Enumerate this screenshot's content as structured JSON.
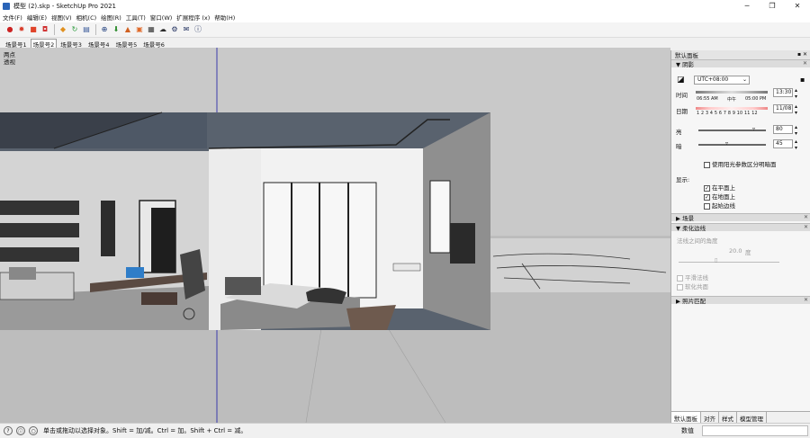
{
  "window": {
    "title": "模型 (2).skp - SketchUp Pro 2021",
    "minimize": "─",
    "maximize": "❐",
    "close": "✕"
  },
  "menu": [
    "文件(F)",
    "编辑(E)",
    "视图(V)",
    "相机(C)",
    "绘图(R)",
    "工具(T)",
    "窗口(W)",
    "扩展程序 (x)",
    "帮助(H)"
  ],
  "toolbar": {
    "icons": [
      {
        "name": "component-icon",
        "glyph": "●",
        "color": "#cc2222"
      },
      {
        "name": "settings-gear-icon",
        "glyph": "✹",
        "color": "#d83c2a"
      },
      {
        "name": "folder-icon",
        "glyph": "■",
        "color": "#e0442a"
      },
      {
        "name": "camera-icon",
        "glyph": "◘",
        "color": "#d03232"
      },
      {
        "name": "plugin-box-icon",
        "glyph": "◆",
        "color": "#e09020"
      },
      {
        "name": "refresh-icon",
        "glyph": "↻",
        "color": "#2a9a3a"
      },
      {
        "name": "layers-icon",
        "glyph": "▤",
        "color": "#3a5a9a"
      },
      {
        "name": "add-circle-icon",
        "glyph": "⊕",
        "color": "#1a3a7a"
      },
      {
        "name": "download-icon",
        "glyph": "⬇",
        "color": "#2a8a2a"
      },
      {
        "name": "terrain-icon",
        "glyph": "▲",
        "color": "#d06020"
      },
      {
        "name": "material-icon",
        "glyph": "▣",
        "color": "#e06a2a"
      },
      {
        "name": "checker-icon",
        "glyph": "▦",
        "color": "#333333"
      },
      {
        "name": "cloud-icon",
        "glyph": "☁",
        "color": "#2a2a2a"
      },
      {
        "name": "gear-plugin-icon",
        "glyph": "⚙",
        "color": "#1a2a5a"
      },
      {
        "name": "mail-icon",
        "glyph": "✉",
        "color": "#1a2a5a"
      },
      {
        "name": "info-icon",
        "glyph": "ⓘ",
        "color": "#1a2a5a"
      }
    ]
  },
  "scenes": {
    "tabs": [
      "场景号1",
      "场景号2",
      "场景号3",
      "场景号4",
      "场景号5",
      "场景号6"
    ],
    "active_index": 1
  },
  "viewport": {
    "label_line1": "两点",
    "label_line2": "透视"
  },
  "panel": {
    "title": "默认面板",
    "pins": "▪ ✕",
    "shadows": {
      "header": "▼ 阴影",
      "timezone": "UTC+08:00",
      "time_label": "时间",
      "time_value": "13:30",
      "time_morning": "06:55 AM",
      "time_noon": "中午",
      "time_evening": "05:00 PM",
      "date_label": "日期",
      "date_value": "11/08",
      "months": "1 2 3 4 5 6 7 8 9 10 11 12",
      "light_label": "亮",
      "light_value": "80",
      "dark_label": "暗",
      "dark_value": "45",
      "use_sun_label": "使用阳光参数区分明暗面",
      "use_sun_checked": false,
      "display_label": "显示:",
      "on_faces_label": "在平面上",
      "on_faces_checked": true,
      "on_ground_label": "在地面上",
      "on_ground_checked": true,
      "from_edges_label": "起始边线",
      "from_edges_checked": false
    },
    "scenes_header": "▶ 场景",
    "soften": {
      "header": "▼ 柔化边线",
      "angle_label": "法线之间的角度",
      "angle_value": "20.0",
      "angle_unit": "度",
      "smooth_normals": "平滑法线",
      "soften_coplanar": "软化共面"
    },
    "photo_match_header": "▶ 照片匹配",
    "tabs": [
      "默认面板",
      "对齐",
      "样式",
      "模型管理"
    ],
    "active_tab": 0
  },
  "status": {
    "icons": [
      "?",
      "ⓘ",
      "○"
    ],
    "text": "单击或拖动以选择对象。Shift = 加/减。Ctrl = 加。Shift + Ctrl = 减。",
    "measure_label": "数值"
  }
}
